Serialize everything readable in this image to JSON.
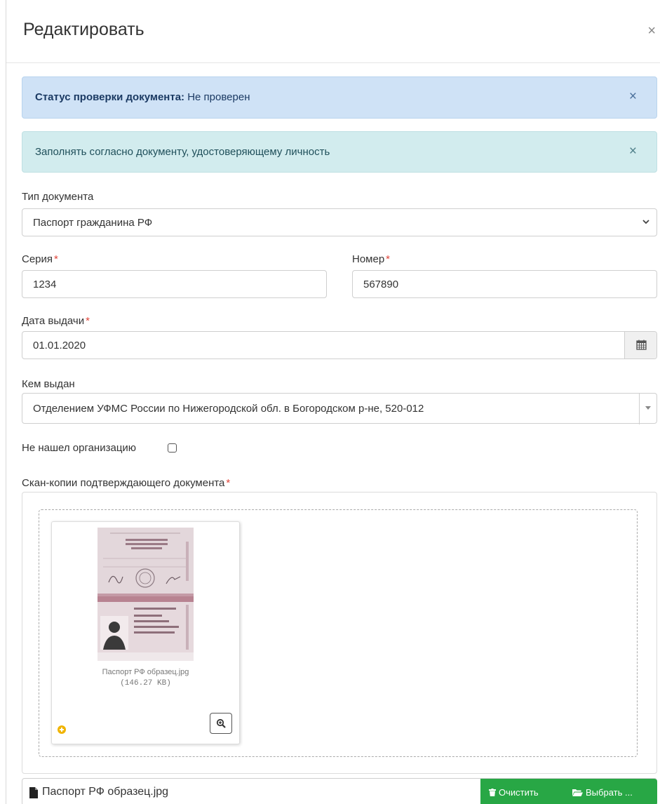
{
  "modal": {
    "title": "Редактировать",
    "close_glyph": "×"
  },
  "alerts": {
    "status_label": "Статус проверки документа:",
    "status_value": " Не проверен",
    "hint": "Заполнять согласно документу, удостоверяющему личность",
    "close_glyph": "×"
  },
  "form": {
    "doc_type": {
      "label": "Тип документа",
      "value": "Паспорт гражданина РФ"
    },
    "series": {
      "label": "Серия",
      "value": "1234"
    },
    "number": {
      "label": "Номер",
      "value": "567890"
    },
    "issue_date": {
      "label": "Дата выдачи",
      "value": "01.01.2020"
    },
    "issued_by": {
      "label": "Кем выдан",
      "value": "Отделением УФМС России по Нижегородской обл. в Богородском р-не, 520-012"
    },
    "not_found_org": {
      "label": "Не нашел организацию",
      "checked": false
    },
    "scans": {
      "label": "Скан-копии подтверждающего документа"
    },
    "required_mark": "*"
  },
  "upload": {
    "file_name": "Паспорт РФ образец.jpg",
    "file_size": "(146.27 KB)",
    "caption_text": "Паспорт РФ образец.jpg",
    "clear_label": "Очистить",
    "browse_label": "Выбрать ..."
  },
  "icons": {
    "close": "close-icon",
    "chevron": "chevron-down-icon",
    "calendar": "calendar-icon",
    "caret": "caret-down-icon",
    "zoom": "zoom-in-icon",
    "file": "file-icon",
    "trash": "trash-icon",
    "folder": "folder-open-icon",
    "drag": "drag-handle-icon"
  },
  "colors": {
    "info_alert_bg": "#cfe2f6",
    "hint_alert_bg": "#d2ecee",
    "required": "#e0453a",
    "button_green": "#28a745",
    "drag_handle": "#f0b400"
  }
}
